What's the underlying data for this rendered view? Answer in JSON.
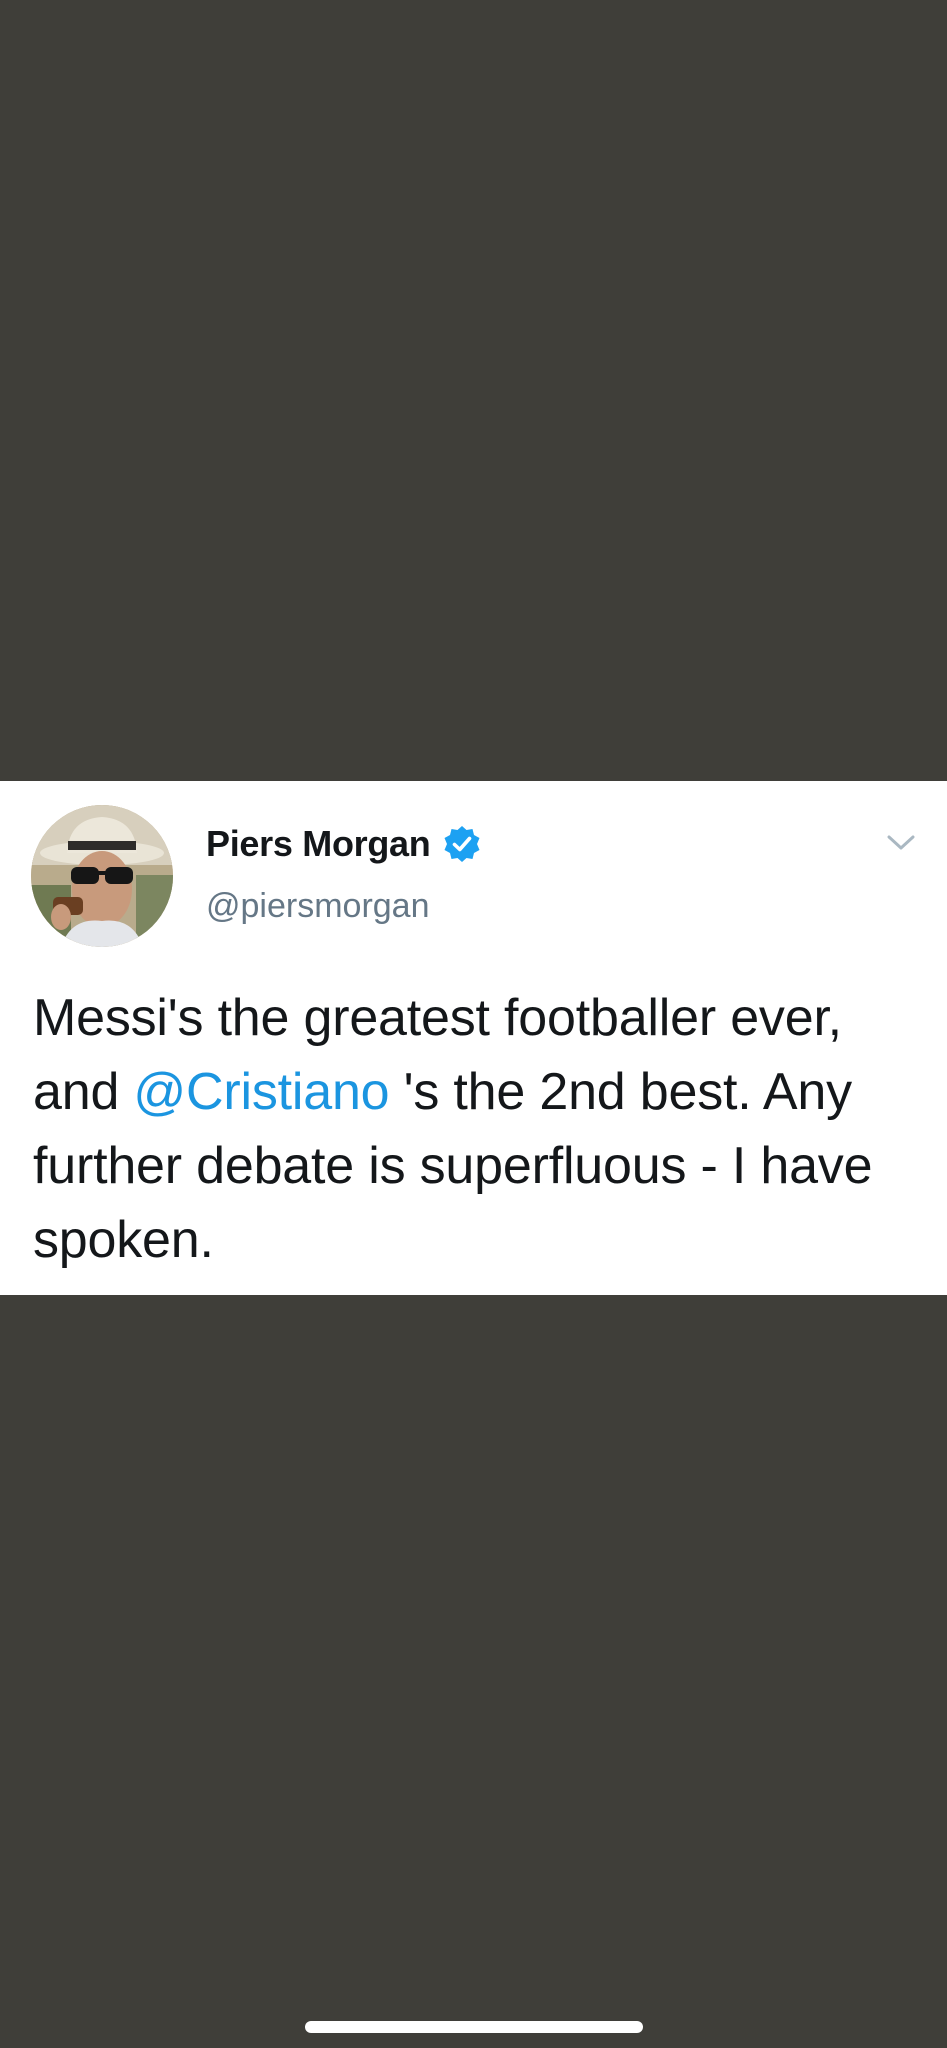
{
  "tweet": {
    "display_name": "Piers Morgan",
    "handle": "@piersmorgan",
    "verified": true,
    "text_part1": "Messi's the greatest footballer ever, and ",
    "mention": "@Cristiano",
    "text_part2": " 's the 2nd best. Any further debate is superfluous - I have spoken."
  },
  "icons": {
    "verified": "verified-badge-icon",
    "menu": "chevron-down-icon"
  },
  "colors": {
    "background": "#3f3e39",
    "card": "#ffffff",
    "mention": "#1b95e0",
    "verified_badge": "#1da1f2",
    "handle": "#657786"
  }
}
